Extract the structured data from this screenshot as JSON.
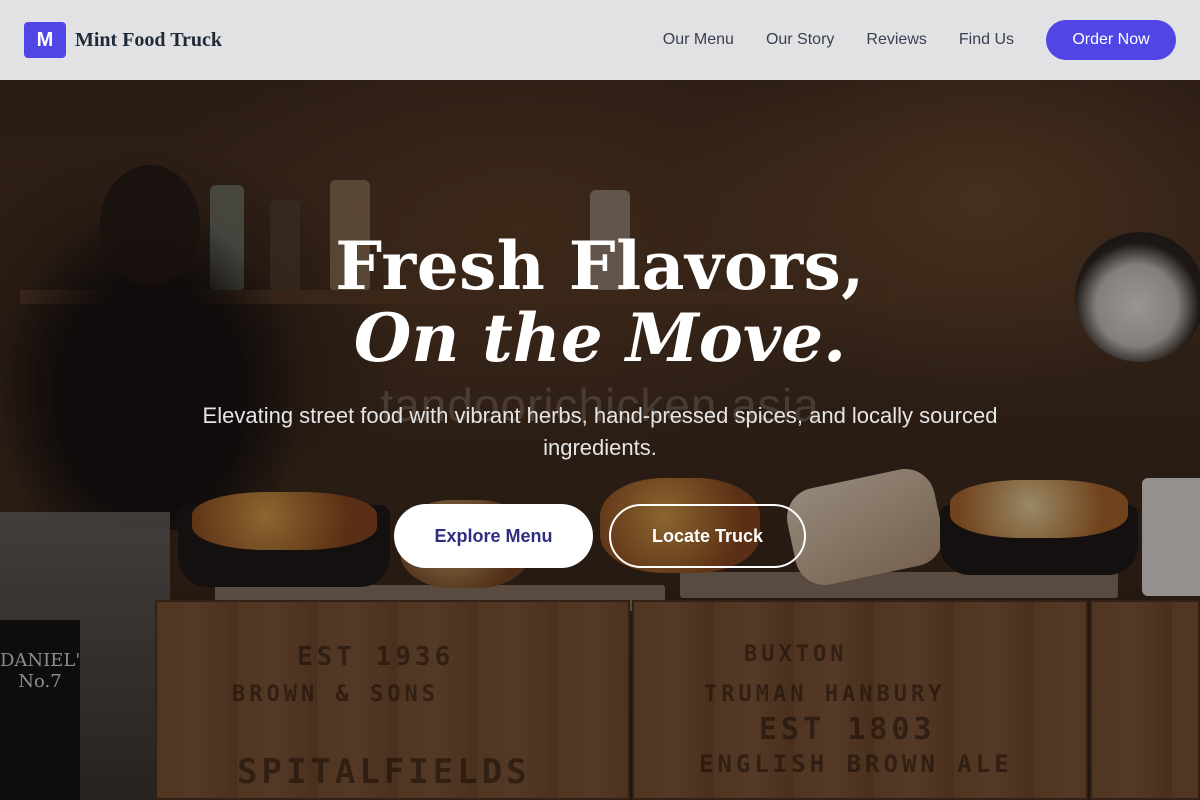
{
  "nav": {
    "logo_letter": "M",
    "brand": "Mint Food Truck",
    "links": [
      "Our Menu",
      "Our Story",
      "Reviews",
      "Find Us"
    ],
    "cta": "Order Now"
  },
  "hero": {
    "title_line1": "Fresh Flavors,",
    "title_line2": "On the Move.",
    "subtitle": "Elevating street food with vibrant herbs, hand-pressed spices, and locally sourced ingredients.",
    "primary_button": "Explore Menu",
    "secondary_button": "Locate Truck",
    "watermark": "tandoorichicken.asia"
  },
  "colors": {
    "accent": "#4f46e5",
    "primary_button_text": "#312e81"
  }
}
